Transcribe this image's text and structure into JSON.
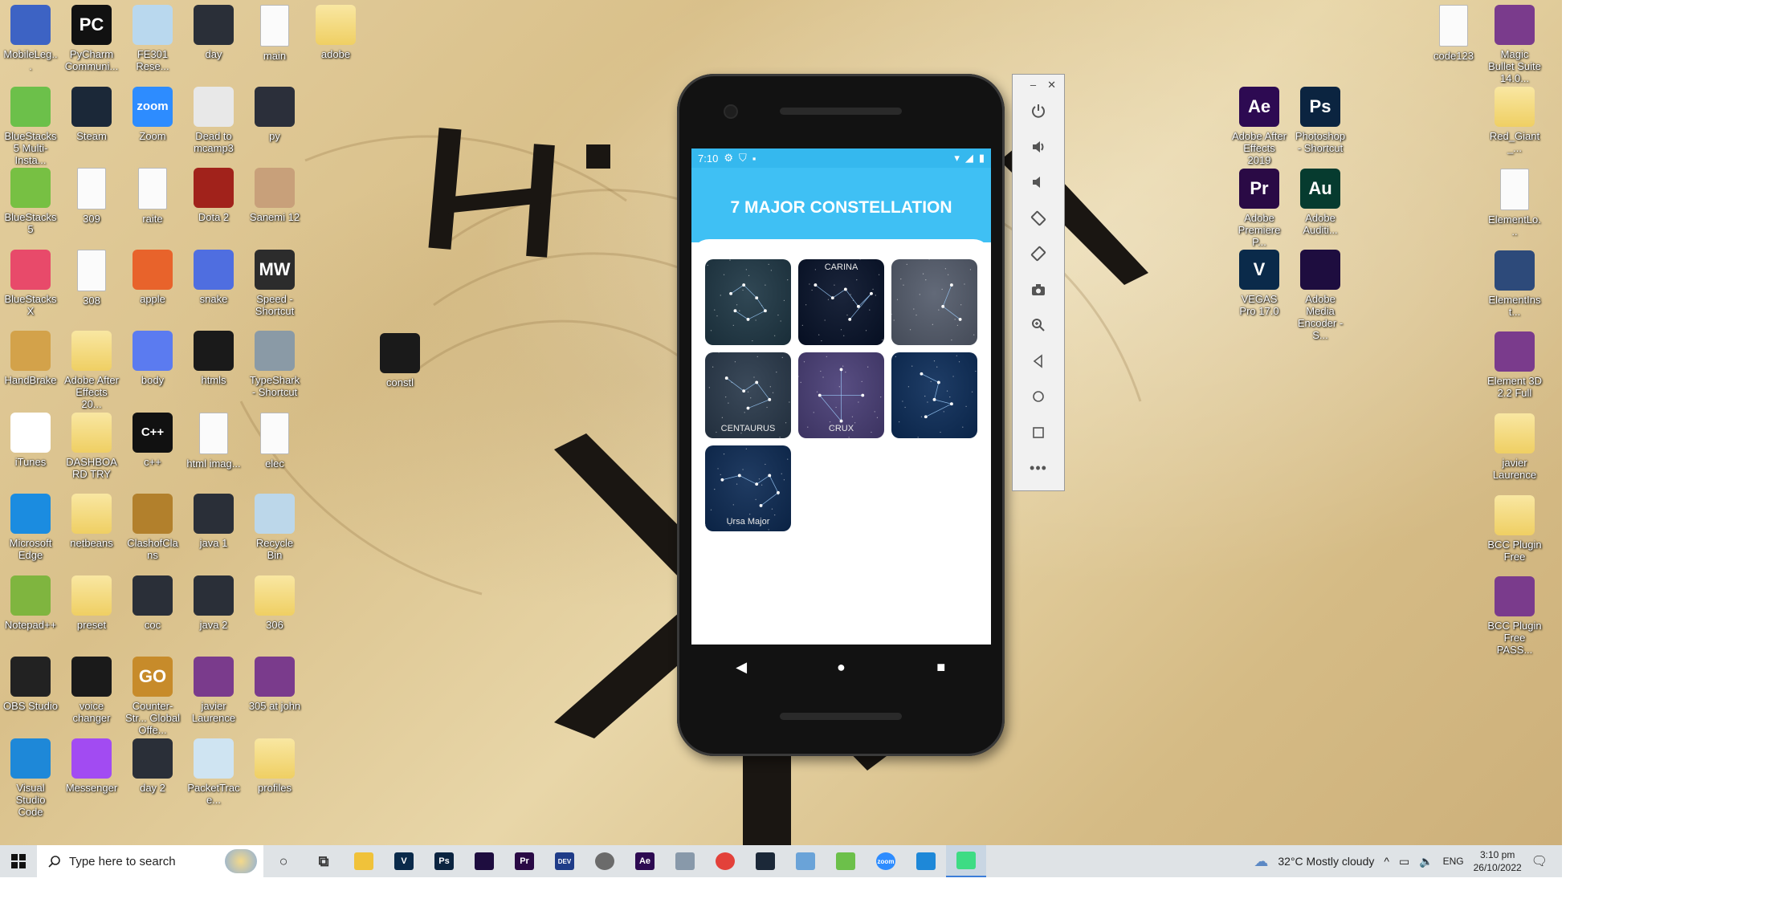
{
  "desktop": {
    "icons_left": [
      {
        "label": "MobileLeg...",
        "icon": "mobile-legends-icon",
        "color": "#3d63c4",
        "text": ""
      },
      {
        "label": "PyCharm Communi...",
        "icon": "pycharm-icon",
        "color": "#111111",
        "text": "PC"
      },
      {
        "label": "FE301 Rese...",
        "icon": "notepad-file-icon",
        "color": "#b9d8ee",
        "text": ""
      },
      {
        "label": "day",
        "icon": "video-thumbnail-icon",
        "color": "#2a2f38",
        "text": ""
      },
      {
        "label": "main",
        "icon": "text-file-icon",
        "color": "#fbfbfb",
        "text": ""
      },
      {
        "label": "adobe",
        "icon": "folder-icon",
        "color": "#f2d26a",
        "text": ""
      },
      {
        "label": "BlueStacks 5 Multi-Insta...",
        "icon": "bluestacks-multi-icon",
        "color": "#6cc04a",
        "text": ""
      },
      {
        "label": "Steam",
        "icon": "steam-icon",
        "color": "#1b2838",
        "text": ""
      },
      {
        "label": "Zoom",
        "icon": "zoom-icon",
        "color": "#2d8cff",
        "text": "zoom"
      },
      {
        "label": "Dead to mcamp3",
        "icon": "audio-file-icon",
        "color": "#e8e8e8",
        "text": ""
      },
      {
        "label": "py",
        "icon": "python-thumbnail-icon",
        "color": "#2b2f3a",
        "text": ""
      },
      {
        "label": "BlueStacks 5",
        "icon": "bluestacks-icon",
        "color": "#77c043",
        "text": ""
      },
      {
        "label": "309",
        "icon": "text-file-icon",
        "color": "#fbfbfb",
        "text": ""
      },
      {
        "label": "raite",
        "icon": "text-file-icon",
        "color": "#fbfbfb",
        "text": ""
      },
      {
        "label": "Dota 2",
        "icon": "dota2-icon",
        "color": "#a1221b",
        "text": ""
      },
      {
        "label": "Sanemi 12",
        "icon": "image-thumbnail-icon",
        "color": "#c8a07a",
        "text": ""
      },
      {
        "label": "BlueStacks X",
        "icon": "bluestacks-x-icon",
        "color": "#e84a6a",
        "text": ""
      },
      {
        "label": "308",
        "icon": "text-file-icon",
        "color": "#333333",
        "text": ""
      },
      {
        "label": "apple",
        "icon": "apple-icon",
        "color": "#e8632b",
        "text": ""
      },
      {
        "label": "snake",
        "icon": "snake-icon",
        "color": "#4f6ee0",
        "text": ""
      },
      {
        "label": "Speed - Shortcut",
        "icon": "nfs-icon",
        "color": "#2c2c2c",
        "text": "MW"
      },
      {
        "label": "HandBrake",
        "icon": "handbrake-icon",
        "color": "#d3a24a",
        "text": ""
      },
      {
        "label": "Adobe After Effects 20...",
        "icon": "folder-icon",
        "color": "#f2d26a",
        "text": ""
      },
      {
        "label": "body",
        "icon": "image-thumbnail-icon",
        "color": "#5b7bf0",
        "text": ""
      },
      {
        "label": "htmls",
        "icon": "phone-thumbnail-icon",
        "color": "#1a1a1a",
        "text": ""
      },
      {
        "label": "TypeShark - Shortcut",
        "icon": "typeshark-icon",
        "color": "#8a9aa6",
        "text": ""
      },
      {
        "label": "iTunes",
        "icon": "itunes-icon",
        "color": "#ffffff",
        "text": ""
      },
      {
        "label": "DASHBOARD TRY",
        "icon": "folder-icon",
        "color": "#f2d26a",
        "text": ""
      },
      {
        "label": "c++",
        "icon": "cpp-icon",
        "color": "#111111",
        "text": "C++"
      },
      {
        "label": "html imag...",
        "icon": "chrome-file-icon",
        "color": "#fbfbfb",
        "text": ""
      },
      {
        "label": "elec",
        "icon": "text-file-icon",
        "color": "#fbfbfb",
        "text": ""
      },
      {
        "label": "Microsoft Edge",
        "icon": "edge-icon",
        "color": "#1b8ce0",
        "text": ""
      },
      {
        "label": "netbeans",
        "icon": "folder-icon",
        "color": "#f2d26a",
        "text": ""
      },
      {
        "label": "ClashofClans",
        "icon": "clash-icon",
        "color": "#b2802c",
        "text": ""
      },
      {
        "label": "java 1",
        "icon": "video-thumbnail-icon",
        "color": "#2a2f38",
        "text": ""
      },
      {
        "label": "Recycle Bin",
        "icon": "recycle-bin-icon",
        "color": "#bcd7ea",
        "text": ""
      },
      {
        "label": "Notepad++",
        "icon": "notepad-plus-icon",
        "color": "#7fb53f",
        "text": ""
      },
      {
        "label": "preset",
        "icon": "folder-icon",
        "color": "#f2d26a",
        "text": ""
      },
      {
        "label": "coc",
        "icon": "video-thumbnail-icon",
        "color": "#2a2f38",
        "text": ""
      },
      {
        "label": "java 2",
        "icon": "video-thumbnail-icon",
        "color": "#2a2f38",
        "text": ""
      },
      {
        "label": "306",
        "icon": "folder-icon",
        "color": "#f2d26a",
        "text": ""
      },
      {
        "label": "OBS Studio",
        "icon": "obs-icon",
        "color": "#222222",
        "text": ""
      },
      {
        "label": "voice changer",
        "icon": "app-icon",
        "color": "#1a1a1a",
        "text": ""
      },
      {
        "label": "Counter-Str... Global Offe...",
        "icon": "csgo-icon",
        "color": "#c78b2a",
        "text": "GO"
      },
      {
        "label": "javier Laurence",
        "icon": "winrar-icon",
        "color": "#7a3b8c",
        "text": ""
      },
      {
        "label": "305 at john",
        "icon": "winrar-icon",
        "color": "#7a3b8c",
        "text": ""
      },
      {
        "label": "Visual Studio Code",
        "icon": "vscode-icon",
        "color": "#1e88d8",
        "text": ""
      },
      {
        "label": "Messenger",
        "icon": "messenger-icon",
        "color": "#a24bf2",
        "text": ""
      },
      {
        "label": "day 2",
        "icon": "video-thumbnail-icon",
        "color": "#2a2f38",
        "text": ""
      },
      {
        "label": "PacketTrace...",
        "icon": "packet-tracer-icon",
        "color": "#cfe4f2",
        "text": ""
      },
      {
        "label": "profiles",
        "icon": "folder-icon",
        "color": "#f2d26a",
        "text": ""
      }
    ],
    "icon_constl": {
      "label": "constl",
      "icon": "app-icon",
      "color": "#1a1a1a"
    },
    "icons_right_a": [
      {
        "label": "Adobe After Effects 2019",
        "icon": "after-effects-icon",
        "color": "#2d0a52",
        "text": "Ae"
      },
      {
        "label": "Photoshop - Shortcut",
        "icon": "photoshop-icon",
        "color": "#0b2440",
        "text": "Ps"
      },
      {
        "label": "Adobe Premiere P...",
        "icon": "premiere-icon",
        "color": "#2a0a45",
        "text": "Pr"
      },
      {
        "label": "Adobe Auditi...",
        "icon": "audition-icon",
        "color": "#063b2f",
        "text": "Au"
      },
      {
        "label": "VEGAS Pro 17.0",
        "icon": "vegas-icon",
        "color": "#0a2a4a",
        "text": "V"
      },
      {
        "label": "Adobe Media Encoder - S...",
        "icon": "media-encoder-icon",
        "color": "#1e0d3f",
        "text": ""
      }
    ],
    "icons_right_b": [
      {
        "label": "code123",
        "icon": "text-file-icon",
        "color": "#fbfbfb",
        "text": ""
      },
      {
        "label": "Magic Bullet Suite 14.0...",
        "icon": "winrar-icon",
        "color": "#7a3b8c",
        "text": ""
      },
      {
        "label": "Red_Giant_...",
        "icon": "folder-icon",
        "color": "#f2d26a",
        "text": ""
      },
      {
        "label": "ElementLo...",
        "icon": "file-icon",
        "color": "#fbfbfb",
        "text": ""
      },
      {
        "label": "ElementInst...",
        "icon": "element-install-icon",
        "color": "#2d4a7a",
        "text": ""
      },
      {
        "label": "Element 3D 2.2 Full",
        "icon": "winrar-icon",
        "color": "#7a3b8c",
        "text": ""
      },
      {
        "label": "javier Laurence",
        "icon": "folder-icon",
        "color": "#f2d26a",
        "text": ""
      },
      {
        "label": "BCC Plugin Free",
        "icon": "folder-icon",
        "color": "#f2d26a",
        "text": ""
      },
      {
        "label": "BCC Plugin Free PASS...",
        "icon": "winrar-icon",
        "color": "#7a3b8c",
        "text": ""
      }
    ]
  },
  "emulator": {
    "status": {
      "time": "7:10"
    },
    "app_title": "7 MAJOR CONSTELLATION",
    "accent": "#3fc0f4",
    "cards": [
      {
        "name": "constellation-1",
        "bg": "#1f3846",
        "caption": ""
      },
      {
        "name": "constellation-carina",
        "bg": "#07122a",
        "caption": "CARINA"
      },
      {
        "name": "constellation-3",
        "bg": "#555d6d",
        "caption": ""
      },
      {
        "name": "constellation-centaurus",
        "bg": "#2a3a4c",
        "caption": "CENTAURUS"
      },
      {
        "name": "constellation-crux",
        "bg": "#4a3f78",
        "caption": "CRUX"
      },
      {
        "name": "constellation-orion",
        "bg": "#0c2d5a",
        "caption": ""
      },
      {
        "name": "constellation-ursa-major",
        "bg": "#0d2b55",
        "caption": "Ursa Major"
      }
    ]
  },
  "taskbar": {
    "search_placeholder": "Type here to search",
    "weather": "32°C  Mostly cloudy",
    "language": "ENG",
    "time": "3:10 pm",
    "date": "26/10/2022",
    "apps": [
      {
        "icon": "cortana-icon",
        "color": "#333333",
        "text": "○"
      },
      {
        "icon": "task-view-icon",
        "color": "#333333",
        "text": "⧉"
      },
      {
        "icon": "file-explorer-icon",
        "color": "#f0c23a",
        "text": ""
      },
      {
        "icon": "vegas-taskbar-icon",
        "color": "#0a2a4a",
        "text": "V"
      },
      {
        "icon": "photoshop-taskbar-icon",
        "color": "#0b2440",
        "text": "Ps"
      },
      {
        "icon": "media-encoder-taskbar-icon",
        "color": "#1e0d3f",
        "text": ""
      },
      {
        "icon": "premiere-taskbar-icon",
        "color": "#2a0a45",
        "text": "Pr"
      },
      {
        "icon": "devcpp-taskbar-icon",
        "color": "#1f3c88",
        "text": "DEV"
      },
      {
        "icon": "audio-taskbar-icon",
        "color": "#6b6b6b",
        "text": ""
      },
      {
        "icon": "after-effects-taskbar-icon",
        "color": "#2d0a52",
        "text": "Ae"
      },
      {
        "icon": "hand-taskbar-icon",
        "color": "#8899aa",
        "text": ""
      },
      {
        "icon": "chrome-taskbar-icon",
        "color": "#e3413a",
        "text": ""
      },
      {
        "icon": "steam-taskbar-icon",
        "color": "#1b2838",
        "text": ""
      },
      {
        "icon": "cube-taskbar-icon",
        "color": "#6aa3d8",
        "text": ""
      },
      {
        "icon": "bluestacks-taskbar-icon",
        "color": "#6cc04a",
        "text": ""
      },
      {
        "icon": "zoom-taskbar-icon",
        "color": "#2d8cff",
        "text": "zoom"
      },
      {
        "icon": "vscode-taskbar-icon",
        "color": "#1e88d8",
        "text": ""
      },
      {
        "icon": "android-studio-taskbar-icon",
        "color": "#3ddc84",
        "text": ""
      }
    ]
  }
}
